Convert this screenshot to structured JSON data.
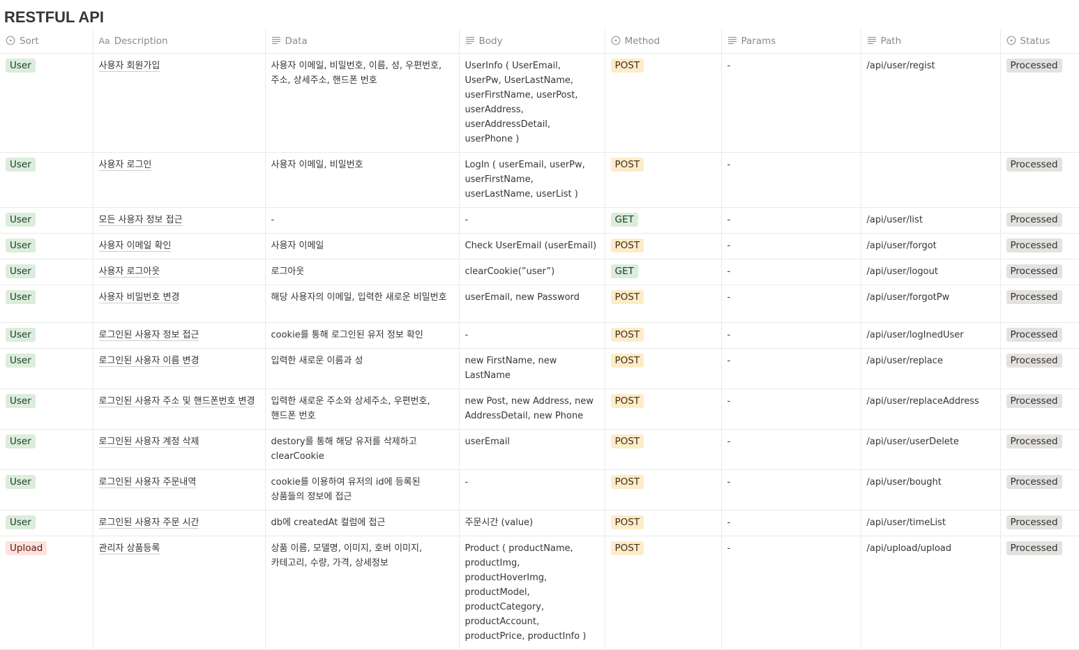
{
  "page": {
    "title": "RESTFUL API"
  },
  "columns": {
    "sort": "Sort",
    "description": "Description",
    "data": "Data",
    "body": "Body",
    "method": "Method",
    "params": "Params",
    "path": "Path",
    "status": "Status"
  },
  "column_icons": {
    "sort": "select-icon",
    "description": "title-aa-icon",
    "data": "text-lines-icon",
    "body": "text-lines-icon",
    "method": "select-icon",
    "params": "text-lines-icon",
    "path": "text-lines-icon",
    "status": "select-icon"
  },
  "tag_colors": {
    "User": "#dbeddb",
    "Upload": "#ffe2dd",
    "POST": "#fdecc8",
    "GET": "#dbeddb",
    "Processed": "#e3e2e0"
  },
  "rows": [
    {
      "sort": "User",
      "description": "사용자 회원가입",
      "data": "사용자 이메일, 비밀번호, 이름, 성, 우편번호, 주소, 상세주소, 핸드폰 번호",
      "body": "UserInfo ( UserEmail, UserPw, UserLastName, userFirstName, userPost, userAddress, userAddressDetail, userPhone )",
      "method": "POST",
      "params": "-",
      "path": "/api/user/regist",
      "status": "Processed"
    },
    {
      "sort": "User",
      "description": "사용자 로그인",
      "data": "사용자 이메일, 비밀번호",
      "body": "LogIn ( userEmail, userPw, userFirstName, userLastName, userList )",
      "method": "POST",
      "params": "-",
      "path": "",
      "status": "Processed"
    },
    {
      "sort": "User",
      "description": "모든 사용자 정보 접근",
      "data": "-",
      "body": "-",
      "method": "GET",
      "params": "-",
      "path": "/api/user/list",
      "status": "Processed"
    },
    {
      "sort": "User",
      "description": "사용자 이메일 확인",
      "data": "사용자 이메일",
      "body": "Check UserEmail (userEmail)",
      "method": "POST",
      "params": "-",
      "path": "/api/user/forgot",
      "status": "Processed"
    },
    {
      "sort": "User",
      "description": "사용자 로그아웃",
      "data": "로그아웃",
      "body": "clearCookie(”user”)",
      "method": "GET",
      "params": "-",
      "path": "/api/user/logout",
      "status": "Processed"
    },
    {
      "sort": "User",
      "description": "사용자 비밀번호 변경",
      "data": "해당 사용자의 이메일, 입력한 새로운 비밀번호",
      "body": "userEmail, new Password",
      "method": "POST",
      "params": "-",
      "path": "/api/user/forgotPw",
      "status": "Processed"
    },
    {
      "sort": "User",
      "description": "로그인된 사용자 정보 접근",
      "data": "cookie를 통해 로그인된 유저 정보 확인",
      "body": "-",
      "method": "POST",
      "params": "-",
      "path": "/api/user/logInedUser",
      "status": "Processed"
    },
    {
      "sort": "User",
      "description": "로그인된 사용자 이름 변경",
      "data": "입력한 새로운 이름과 성",
      "body": "new FirstName, new LastName",
      "method": "POST",
      "params": "-",
      "path": "/api/user/replace",
      "status": "Processed"
    },
    {
      "sort": "User",
      "description": "로그인된 사용자 주소 및 핸드폰번호 변경",
      "data": "입력한 새로운 주소와 상세주소, 우편번호, 핸드폰 번호",
      "body": "new Post, new Address, new AddressDetail, new Phone",
      "method": "POST",
      "params": "-",
      "path": "/api/user/replaceAddress",
      "status": "Processed"
    },
    {
      "sort": "User",
      "description": "로그인된 사용자 계정 삭제",
      "data": "destory를 통해 해당 유저를 삭제하고 clearCookie",
      "body": "userEmail",
      "method": "POST",
      "params": "-",
      "path": "/api/user/userDelete",
      "status": "Processed"
    },
    {
      "sort": "User",
      "description": "로그인된 사용자 주문내역",
      "data": "cookie를 이용하여 유저의 id에 등록된 상품들의 정보에 접근",
      "body": "-",
      "method": "POST",
      "params": "-",
      "path": "/api/user/bought",
      "status": "Processed"
    },
    {
      "sort": "User",
      "description": "로그인된 사용자 주문 시간",
      "data": "db에 createdAt 컬럼에 접근",
      "body": "주문시간 (value)",
      "method": "POST",
      "params": "-",
      "path": "/api/user/timeList",
      "status": "Processed"
    },
    {
      "sort": "Upload",
      "description": "관리자 상품등록",
      "data": "상품 이름, 모델명, 이미지, 호버 이미지, 카테고리, 수량, 가격, 상세정보",
      "body": "Product ( productName, productImg, productHoverImg, productModel, productCategory, productAccount, productPrice, productInfo )",
      "method": "POST",
      "params": "-",
      "path": "/api/upload/upload",
      "status": "Processed"
    }
  ]
}
